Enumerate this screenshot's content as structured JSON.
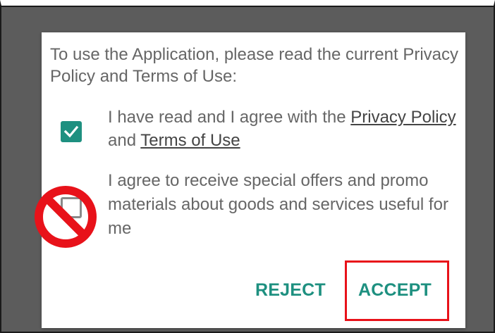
{
  "dialog": {
    "intro_text": "To use the Application, please read the current Privacy Policy and Terms of Use:",
    "consent_privacy": {
      "checked": true,
      "text_before": "I have read and I agree with the ",
      "link_privacy": "Privacy Policy",
      "text_middle": " and ",
      "link_terms": "Terms of Use"
    },
    "consent_offers": {
      "checked": false,
      "text": "I agree to receive special offers and promo materials about goods and services useful for me"
    },
    "buttons": {
      "reject_label": "REJECT",
      "accept_label": "ACCEPT"
    }
  },
  "annotations": {
    "prohibit_icon": "prohibited-icon",
    "highlight_color": "#e8121a"
  },
  "colors": {
    "accent": "#1e9080",
    "backdrop": "#5c5c5c",
    "text": "#666666"
  }
}
